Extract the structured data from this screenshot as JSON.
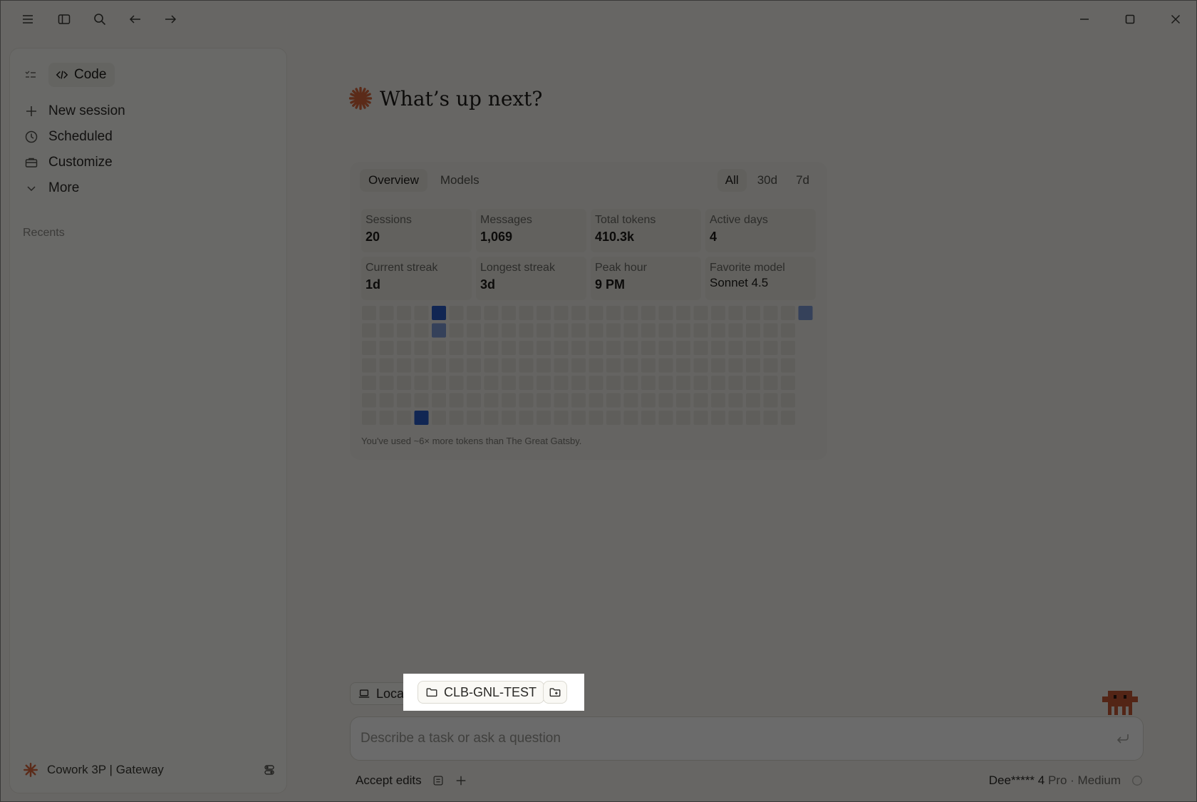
{
  "titlebar": {
    "menu_icon": "hamburger-icon",
    "sidebar_icon": "sidebar-toggle-icon",
    "search_icon": "search-icon",
    "back_icon": "arrow-left-icon",
    "forward_icon": "arrow-right-icon",
    "minimize_icon": "minimize-icon",
    "maximize_icon": "maximize-icon",
    "close_icon": "close-icon"
  },
  "sidebar": {
    "mode_label": "Code",
    "items": [
      {
        "label": "New session",
        "icon": "plus-icon"
      },
      {
        "label": "Scheduled",
        "icon": "clock-icon"
      },
      {
        "label": "Customize",
        "icon": "briefcase-icon"
      },
      {
        "label": "More",
        "icon": "chevron-down-icon"
      }
    ],
    "recents_label": "Recents",
    "footer_label": "Cowork 3P | Gateway"
  },
  "main": {
    "title": "What’s up next?"
  },
  "stats": {
    "tabs": [
      "Overview",
      "Models"
    ],
    "ranges": [
      "All",
      "30d",
      "7d"
    ],
    "metrics": [
      {
        "label": "Sessions",
        "value": "20"
      },
      {
        "label": "Messages",
        "value": "1,069"
      },
      {
        "label": "Total tokens",
        "value": "410.3k"
      },
      {
        "label": "Active days",
        "value": "4"
      },
      {
        "label": "Current streak",
        "value": "1d"
      },
      {
        "label": "Longest streak",
        "value": "3d"
      },
      {
        "label": "Peak hour",
        "value": "9 PM"
      },
      {
        "label": "Favorite model",
        "value": "Sonnet 4.5"
      }
    ],
    "caption": "You've used ~6× more tokens than The Great Gatsby.",
    "colors": {
      "empty": "#e2e1da",
      "low": "#7f9bd6",
      "high": "#2a5cc7"
    }
  },
  "composer": {
    "env_chip": "Local",
    "folder_chip": "CLB-GNL-TEST",
    "placeholder": "Describe a task or ask a question",
    "accept_edits": "Accept edits",
    "model_name": "Dee***** 4",
    "model_tier": "Pro · Medium"
  }
}
